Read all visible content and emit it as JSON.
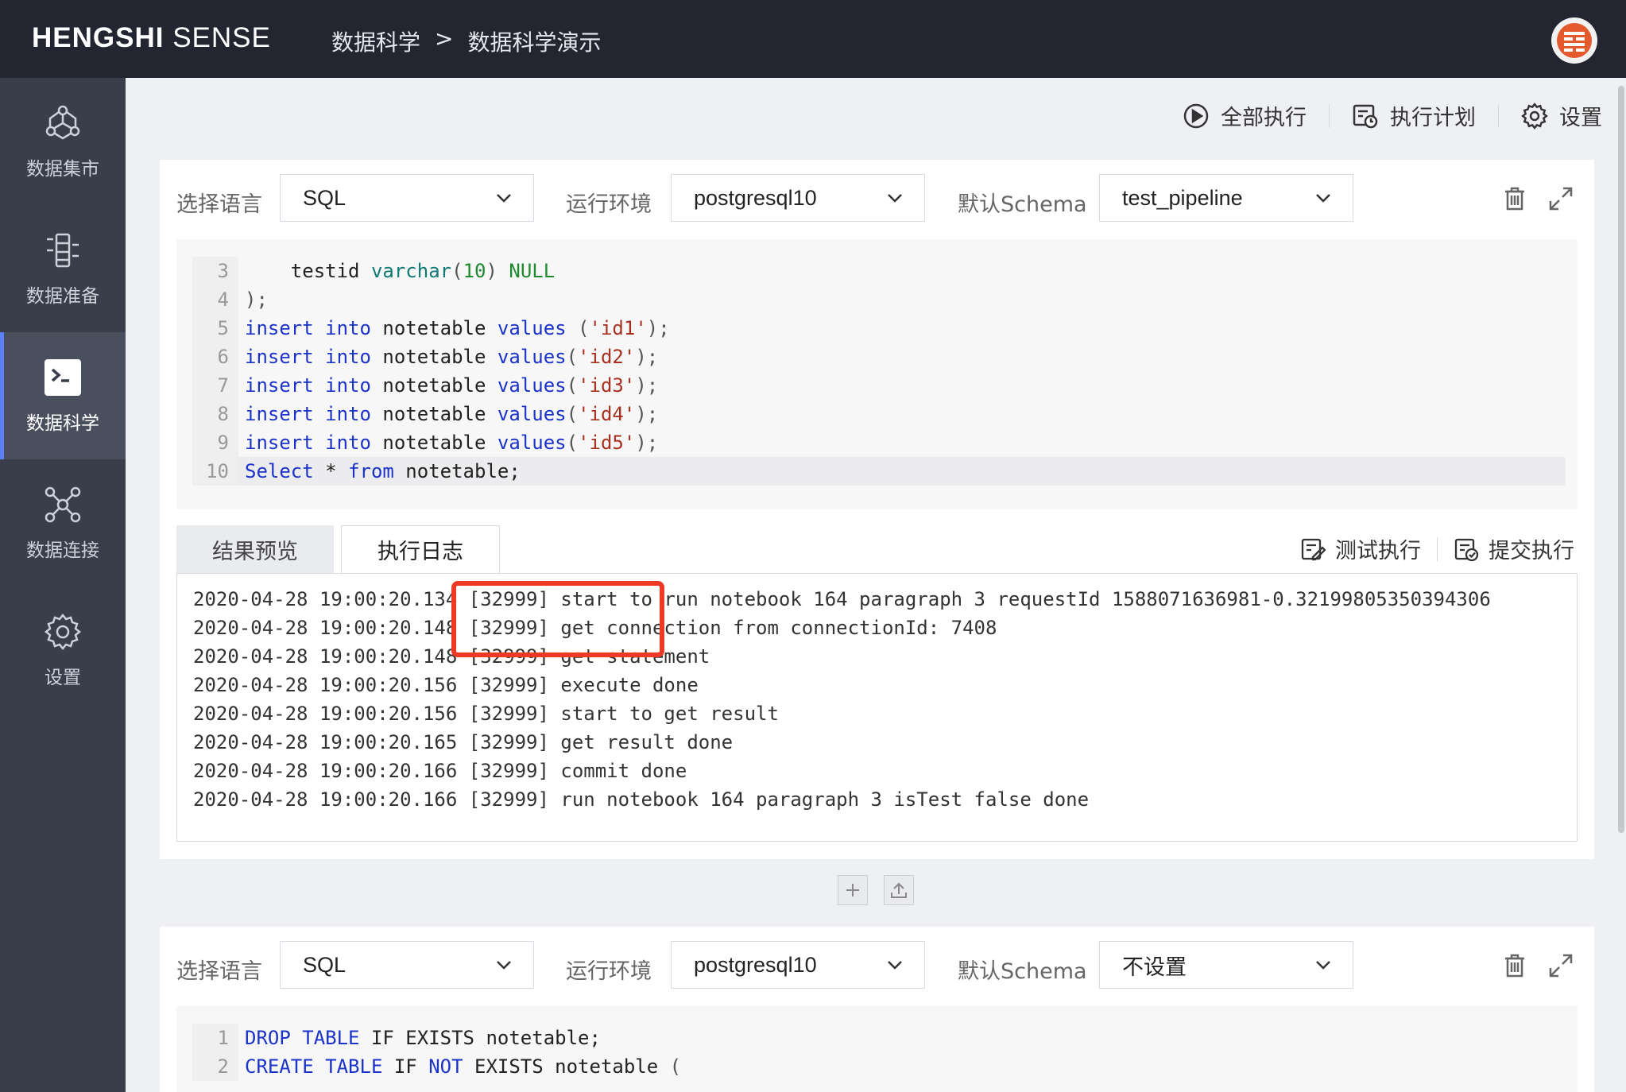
{
  "header": {
    "logo_bold": "HENGSHI",
    "logo_light": "SENSE",
    "breadcrumb": [
      "数据科学",
      ">",
      "数据科学演示"
    ]
  },
  "sidebar": {
    "items": [
      {
        "label": "数据集市",
        "icon": "data-mart-icon"
      },
      {
        "label": "数据准备",
        "icon": "data-prep-icon"
      },
      {
        "label": "数据科学",
        "icon": "terminal-icon",
        "active": true
      },
      {
        "label": "数据连接",
        "icon": "network-icon"
      },
      {
        "label": "设置",
        "icon": "gear-icon"
      }
    ]
  },
  "toolbar": {
    "run_all": "全部执行",
    "schedule": "执行计划",
    "settings": "设置"
  },
  "paragraph1": {
    "lang_label": "选择语言",
    "lang_value": "SQL",
    "env_label": "运行环境",
    "env_value": "postgresql10",
    "schema_label": "默认Schema",
    "schema_value": "test_pipeline",
    "code": [
      {
        "n": "3",
        "tokens": [
          [
            "p",
            "    testid "
          ],
          [
            "ty",
            "varchar"
          ],
          [
            "pn",
            "("
          ],
          [
            "nl",
            "10"
          ],
          [
            "pn",
            ") "
          ],
          [
            "nl",
            "NULL"
          ]
        ]
      },
      {
        "n": "4",
        "tokens": [
          [
            "pn",
            ");"
          ]
        ]
      },
      {
        "n": "5",
        "tokens": [
          [
            "kw",
            "insert into"
          ],
          [
            "p",
            " notetable "
          ],
          [
            "kw",
            "values"
          ],
          [
            "pn",
            " ("
          ],
          [
            "st",
            "'id1'"
          ],
          [
            "pn",
            ");"
          ]
        ]
      },
      {
        "n": "6",
        "tokens": [
          [
            "kw",
            "insert into"
          ],
          [
            "p",
            " notetable "
          ],
          [
            "kw",
            "values"
          ],
          [
            "pn",
            "("
          ],
          [
            "st",
            "'id2'"
          ],
          [
            "pn",
            ");"
          ]
        ]
      },
      {
        "n": "7",
        "tokens": [
          [
            "kw",
            "insert into"
          ],
          [
            "p",
            " notetable "
          ],
          [
            "kw",
            "values"
          ],
          [
            "pn",
            "("
          ],
          [
            "st",
            "'id3'"
          ],
          [
            "pn",
            ");"
          ]
        ]
      },
      {
        "n": "8",
        "tokens": [
          [
            "kw",
            "insert into"
          ],
          [
            "p",
            " notetable "
          ],
          [
            "kw",
            "values"
          ],
          [
            "pn",
            "("
          ],
          [
            "st",
            "'id4'"
          ],
          [
            "pn",
            ");"
          ]
        ]
      },
      {
        "n": "9",
        "tokens": [
          [
            "kw",
            "insert into"
          ],
          [
            "p",
            " notetable "
          ],
          [
            "kw",
            "values"
          ],
          [
            "pn",
            "("
          ],
          [
            "st",
            "'id5'"
          ],
          [
            "pn",
            ");"
          ]
        ]
      },
      {
        "n": "10",
        "tokens": [
          [
            "kw",
            "Select"
          ],
          [
            "p",
            " * "
          ],
          [
            "kw",
            "from"
          ],
          [
            "p",
            " notetable;"
          ]
        ],
        "current": true
      }
    ],
    "tabs": {
      "result": "结果预览",
      "log": "执行日志"
    },
    "test_run": "测试执行",
    "submit_run": "提交执行",
    "log_lines": [
      "2020-04-28 19:00:20.134 [32999] start to run notebook 164 paragraph 3 requestId 1588071636981-0.32199805350394306",
      "2020-04-28 19:00:20.148 [32999] get connection from connectionId: 7408",
      "2020-04-28 19:00:20.148 [32999] get statement",
      "2020-04-28 19:00:20.156 [32999] execute done",
      "2020-04-28 19:00:20.156 [32999] start to get result",
      "2020-04-28 19:00:20.165 [32999] get result done",
      "2020-04-28 19:00:20.166 [32999] commit done",
      "2020-04-28 19:00:20.166 [32999] run notebook 164 paragraph 3 isTest false done"
    ]
  },
  "paragraph2": {
    "lang_label": "选择语言",
    "lang_value": "SQL",
    "env_label": "运行环境",
    "env_value": "postgresql10",
    "schema_label": "默认Schema",
    "schema_value": "不设置",
    "code": [
      {
        "n": "1",
        "tokens": [
          [
            "kw",
            "DROP TABLE"
          ],
          [
            "p",
            " IF EXISTS notetable;"
          ]
        ]
      },
      {
        "n": "2",
        "tokens": [
          [
            "kw",
            "CREATE TABLE"
          ],
          [
            "p",
            " IF "
          ],
          [
            "kw",
            "NOT"
          ],
          [
            "p",
            " EXISTS notetable "
          ],
          [
            "pn",
            "("
          ]
        ]
      }
    ]
  },
  "colors": {
    "topbar": "#232630",
    "sidebar": "#3a3e4b",
    "active_accent": "#5b7fff",
    "highlight": "#ee3a24",
    "keyword": "#1b33c9"
  }
}
